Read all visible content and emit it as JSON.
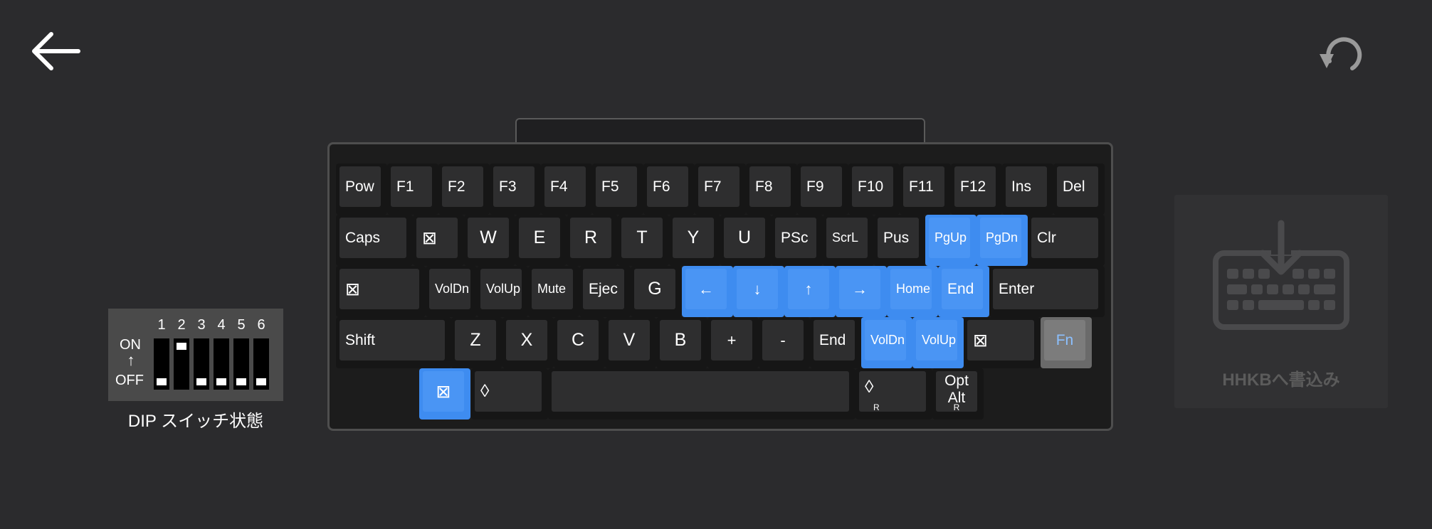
{
  "nav": {
    "back_icon": "arrow-left-icon",
    "reset_icon": "undo-icon"
  },
  "dip": {
    "numbers": [
      "1",
      "2",
      "3",
      "4",
      "5",
      "6"
    ],
    "on_label": "ON",
    "arrow": "↑",
    "off_label": "OFF",
    "states": [
      "off",
      "on",
      "off",
      "off",
      "off",
      "off"
    ],
    "caption": "DIP スイッチ状態"
  },
  "keyboard": {
    "keys": [
      {
        "label": "Pow",
        "hl": "none",
        "size": "sm",
        "align": "left"
      },
      {
        "label": "F1",
        "hl": "none",
        "size": "sm",
        "align": "left"
      },
      {
        "label": "F2",
        "hl": "none",
        "size": "sm",
        "align": "left"
      },
      {
        "label": "F3",
        "hl": "none",
        "size": "sm",
        "align": "left"
      },
      {
        "label": "F4",
        "hl": "none",
        "size": "sm",
        "align": "left"
      },
      {
        "label": "F5",
        "hl": "none",
        "size": "sm",
        "align": "left"
      },
      {
        "label": "F6",
        "hl": "none",
        "size": "sm",
        "align": "left"
      },
      {
        "label": "F7",
        "hl": "none",
        "size": "sm",
        "align": "left"
      },
      {
        "label": "F8",
        "hl": "none",
        "size": "sm",
        "align": "left"
      },
      {
        "label": "F9",
        "hl": "none",
        "size": "sm",
        "align": "left"
      },
      {
        "label": "F10",
        "hl": "none",
        "size": "sm",
        "align": "left"
      },
      {
        "label": "F11",
        "hl": "none",
        "size": "sm",
        "align": "left"
      },
      {
        "label": "F12",
        "hl": "none",
        "size": "sm",
        "align": "left"
      },
      {
        "label": "Ins",
        "hl": "none",
        "size": "sm",
        "align": "left"
      },
      {
        "label": "Del",
        "hl": "none",
        "size": "sm",
        "align": "left"
      },
      {
        "label": "Caps",
        "hl": "none",
        "size": "sm",
        "align": "left"
      },
      {
        "label": "⊠",
        "hl": "none",
        "size": "lg",
        "align": "left"
      },
      {
        "label": "W",
        "hl": "none",
        "size": "lg",
        "align": "center"
      },
      {
        "label": "E",
        "hl": "none",
        "size": "lg",
        "align": "center"
      },
      {
        "label": "R",
        "hl": "none",
        "size": "lg",
        "align": "center"
      },
      {
        "label": "T",
        "hl": "none",
        "size": "lg",
        "align": "center"
      },
      {
        "label": "Y",
        "hl": "none",
        "size": "lg",
        "align": "center"
      },
      {
        "label": "U",
        "hl": "none",
        "size": "lg",
        "align": "center"
      },
      {
        "label": "PSc",
        "hl": "none",
        "size": "sm",
        "align": "left"
      },
      {
        "label": "ScrL",
        "hl": "none",
        "size": "xs",
        "align": "left"
      },
      {
        "label": "Pus",
        "hl": "none",
        "size": "sm",
        "align": "left"
      },
      {
        "label": "PgUp",
        "hl": "blue",
        "size": "xs",
        "align": "left"
      },
      {
        "label": "PgDn",
        "hl": "blue",
        "size": "xs",
        "align": "left"
      },
      {
        "label": "Clr",
        "hl": "none",
        "size": "sm",
        "align": "left"
      },
      {
        "label": "⊠",
        "hl": "none",
        "size": "lg",
        "align": "left"
      },
      {
        "label": "VolDn",
        "hl": "none",
        "size": "xs",
        "align": "left"
      },
      {
        "label": "VolUp",
        "hl": "none",
        "size": "xs",
        "align": "left"
      },
      {
        "label": "Mute",
        "hl": "none",
        "size": "xs",
        "align": "left"
      },
      {
        "label": "Ejec",
        "hl": "none",
        "size": "sm",
        "align": "left"
      },
      {
        "label": "G",
        "hl": "none",
        "size": "lg",
        "align": "center"
      },
      {
        "label": "←",
        "hl": "blue",
        "size": "md",
        "align": "center"
      },
      {
        "label": "↓",
        "hl": "blue",
        "size": "md",
        "align": "center"
      },
      {
        "label": "↑",
        "hl": "blue",
        "size": "md",
        "align": "center"
      },
      {
        "label": "→",
        "hl": "blue",
        "size": "md",
        "align": "center"
      },
      {
        "label": "Home",
        "hl": "blue",
        "size": "xs",
        "align": "left"
      },
      {
        "label": "End",
        "hl": "blue",
        "size": "sm",
        "align": "left"
      },
      {
        "label": "Enter",
        "hl": "none",
        "size": "sm",
        "align": "left"
      },
      {
        "label": "Shift",
        "hl": "none",
        "size": "sm",
        "align": "left"
      },
      {
        "label": "Z",
        "hl": "none",
        "size": "lg",
        "align": "center"
      },
      {
        "label": "X",
        "hl": "none",
        "size": "lg",
        "align": "center"
      },
      {
        "label": "C",
        "hl": "none",
        "size": "lg",
        "align": "center"
      },
      {
        "label": "V",
        "hl": "none",
        "size": "lg",
        "align": "center"
      },
      {
        "label": "B",
        "hl": "none",
        "size": "lg",
        "align": "center"
      },
      {
        "label": "+",
        "hl": "none",
        "size": "md",
        "align": "center"
      },
      {
        "label": "-",
        "hl": "none",
        "size": "md",
        "align": "center"
      },
      {
        "label": "End",
        "hl": "none",
        "size": "sm",
        "align": "left"
      },
      {
        "label": "VolDn",
        "hl": "blue",
        "size": "xs",
        "align": "left"
      },
      {
        "label": "VolUp",
        "hl": "blue",
        "size": "xs",
        "align": "left"
      },
      {
        "label": "⊠",
        "hl": "none",
        "size": "lg",
        "align": "left"
      },
      {
        "label": "Fn",
        "hl": "fn",
        "size": "sm",
        "align": "center"
      },
      {
        "label": "⊠",
        "hl": "blue",
        "size": "lg",
        "align": "center"
      },
      {
        "label": "◊",
        "hl": "none",
        "size": "lg",
        "align": "left"
      },
      {
        "label": "",
        "hl": "none",
        "size": "sm",
        "align": "left"
      },
      {
        "label": "◊",
        "sub": "R",
        "hl": "none",
        "size": "lg",
        "align": "left"
      },
      {
        "label": "Opt\nAlt",
        "sub": "R",
        "hl": "none",
        "size": "sm",
        "align": "stack"
      }
    ]
  },
  "write": {
    "label": "HHKBへ書込み",
    "icon": "keyboard-download-icon"
  }
}
